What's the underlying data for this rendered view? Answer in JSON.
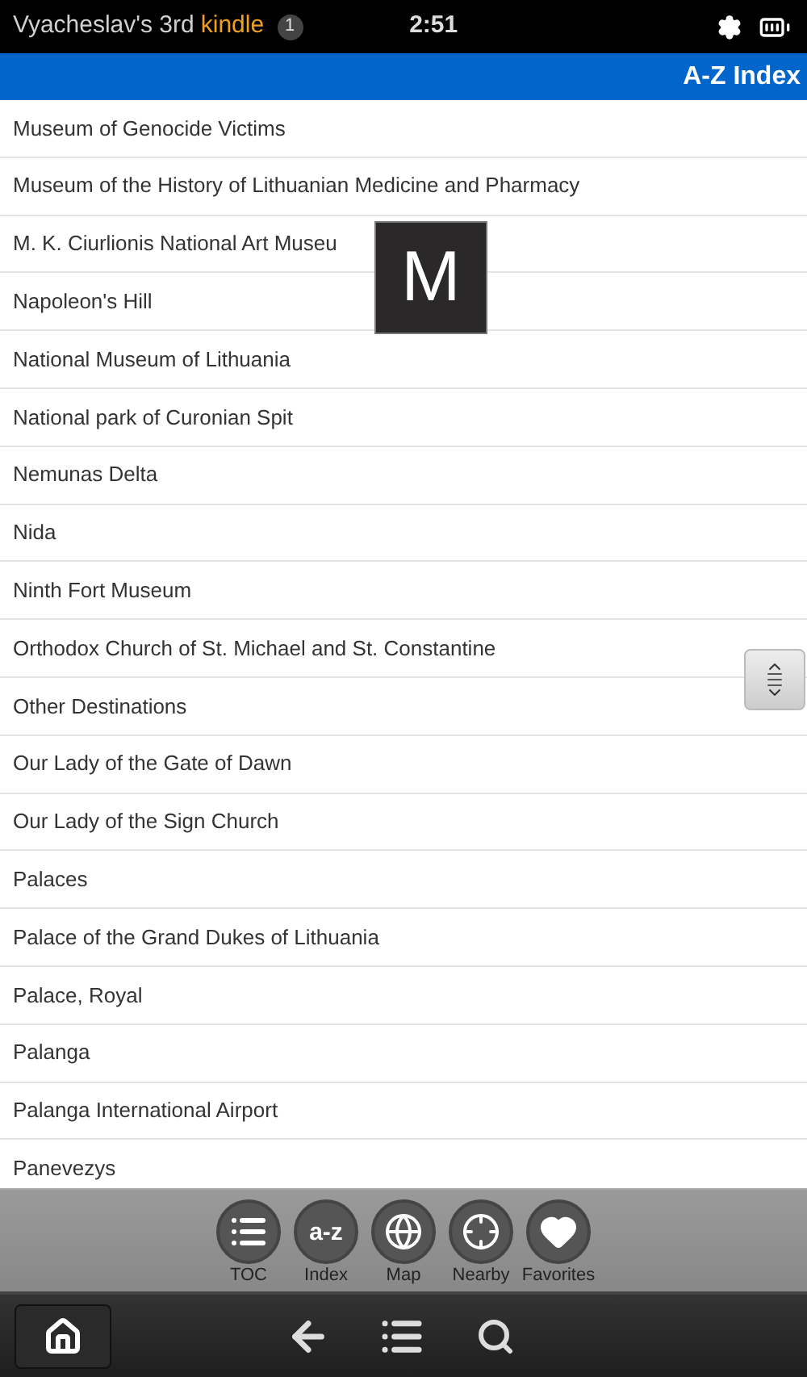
{
  "status_bar": {
    "device_name": "Vyacheslav's 3rd",
    "brand": "kindle",
    "notification_count": "1",
    "time": "2:51"
  },
  "header": {
    "title": "A-Z Index"
  },
  "list": {
    "items": [
      {
        "label": "Museum of Genocide Victims"
      },
      {
        "label": "Museum of the History of Lithuanian Medicine and Pharmacy"
      },
      {
        "label": "M. K. Ciurlionis National Art Museu"
      },
      {
        "label": "Napoleon's Hill"
      },
      {
        "label": "National Museum of Lithuania"
      },
      {
        "label": "National park of Curonian Spit"
      },
      {
        "label": "Nemunas Delta"
      },
      {
        "label": "Nida"
      },
      {
        "label": "Ninth Fort Museum"
      },
      {
        "label": "Orthodox Church of St. Michael and St. Constantine"
      },
      {
        "label": "Other Destinations"
      },
      {
        "label": "Our Lady of the Gate of Dawn"
      },
      {
        "label": "Our Lady of the Sign Church"
      },
      {
        "label": "Palaces"
      },
      {
        "label": "Palace of the Grand Dukes of Lithuania"
      },
      {
        "label": "Palace, Royal"
      },
      {
        "label": "Palanga"
      },
      {
        "label": "Palanga International Airport"
      },
      {
        "label": "Panevezys"
      }
    ]
  },
  "letter_overlay": "M",
  "toolbar": [
    {
      "kind": "toc",
      "label": "TOC"
    },
    {
      "kind": "index",
      "label": "Index",
      "icon_text": "a-z"
    },
    {
      "kind": "map",
      "label": "Map"
    },
    {
      "kind": "nearby",
      "label": "Nearby"
    },
    {
      "kind": "favorites",
      "label": "Favorites"
    }
  ]
}
